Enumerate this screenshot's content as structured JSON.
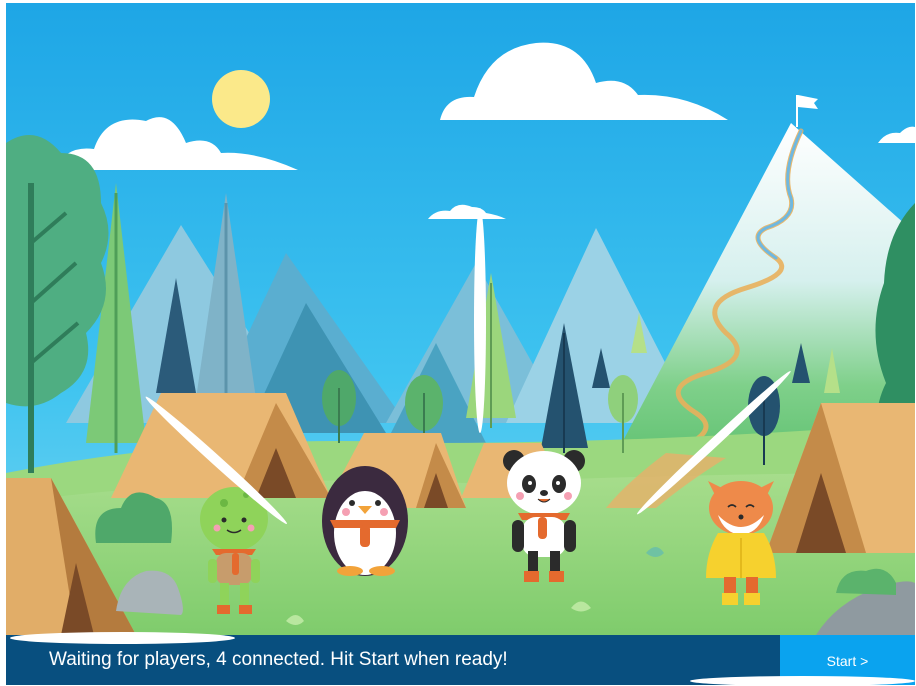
{
  "game": {
    "status_text": "Waiting for players, 4 connected. Hit Start when ready!",
    "start_label": "Start >",
    "players_connected": 4
  },
  "characters": [
    {
      "name": "turtle",
      "icon": "turtle-character"
    },
    {
      "name": "penguin",
      "icon": "penguin-character"
    },
    {
      "name": "panda",
      "icon": "panda-character"
    },
    {
      "name": "fox",
      "icon": "fox-character"
    }
  ],
  "colors": {
    "sky": "#2ab7ec",
    "grass": "#8ed27a",
    "status_bar": "#084f7f",
    "start_button": "#0aa3ef",
    "tent": "#e7b46f"
  }
}
